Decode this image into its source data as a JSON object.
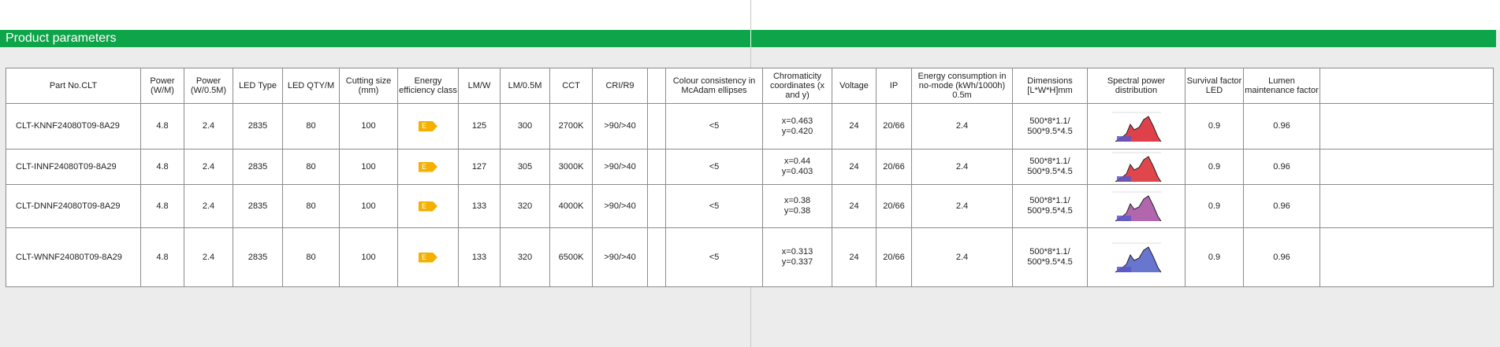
{
  "header": {
    "title": "Product parameters"
  },
  "columns": [
    "Part No.CLT",
    "Power (W/M)",
    "Power (W/0.5M)",
    "LED Type",
    "LED QTY/M",
    "Cutting size (mm)",
    "Energy efficiency class",
    "LM/W",
    "LM/0.5M",
    "CCT",
    "CRI/R9",
    "Colour consistency in McAdam ellipses",
    "Chromaticity coordinates (x and y)",
    "Voltage",
    "IP",
    "Energy consumption in no-mode (kWh/1000h) 0.5m",
    "Dimensions [L*W*H]mm",
    "Spectral power distribution",
    "Survival factor LED",
    "Lumen maintenance factor"
  ],
  "rows": [
    {
      "part": "CLT-KNNF24080T09-8A29",
      "pw_m": "4.8",
      "pw_05": "2.4",
      "led": "2835",
      "qty": "80",
      "cut": "100",
      "ee": "E",
      "lmw": "125",
      "lm05": "300",
      "cct": "2700K",
      "cri": ">90/>40",
      "mcadam": "<5",
      "x": "x=0.463",
      "y": "y=0.420",
      "volt": "24",
      "ip": "20/66",
      "energy": "2.4",
      "dim1": "500*8*1.1/",
      "dim2": "500*9.5*4.5",
      "surv": "0.9",
      "lumen": "0.96",
      "spec_color": "#d8202a"
    },
    {
      "part": "CLT-INNF24080T09-8A29",
      "pw_m": "4.8",
      "pw_05": "2.4",
      "led": "2835",
      "qty": "80",
      "cut": "100",
      "ee": "E",
      "lmw": "127",
      "lm05": "305",
      "cct": "3000K",
      "cri": ">90/>40",
      "mcadam": "<5",
      "x": "x=0.44",
      "y": "y=0.403",
      "volt": "24",
      "ip": "20/66",
      "energy": "2.4",
      "dim1": "500*8*1.1/",
      "dim2": "500*9.5*4.5",
      "surv": "0.9",
      "lumen": "0.96",
      "spec_color": "#d9272b"
    },
    {
      "part": "CLT-DNNF24080T09-8A29",
      "pw_m": "4.8",
      "pw_05": "2.4",
      "led": "2835",
      "qty": "80",
      "cut": "100",
      "ee": "E",
      "lmw": "133",
      "lm05": "320",
      "cct": "4000K",
      "cri": ">90/>40",
      "mcadam": "<5",
      "x": "x=0.38",
      "y": "y=0.38",
      "volt": "24",
      "ip": "20/66",
      "energy": "2.4",
      "dim1": "500*8*1.1/",
      "dim2": "500*9.5*4.5",
      "surv": "0.9",
      "lumen": "0.96",
      "spec_color": "#a44b9f"
    },
    {
      "part": "CLT-WNNF24080T09-8A29",
      "pw_m": "4.8",
      "pw_05": "2.4",
      "led": "2835",
      "qty": "80",
      "cut": "100",
      "ee": "E",
      "lmw": "133",
      "lm05": "320",
      "cct": "6500K",
      "cri": ">90/>40",
      "mcadam": "<5",
      "x": "x=0.313",
      "y": "y=0.337",
      "volt": "24",
      "ip": "20/66",
      "energy": "2.4",
      "dim1": "500*8*1.1/",
      "dim2": "500*9.5*4.5",
      "surv": "0.9",
      "lumen": "0.96",
      "spec_color": "#4d5ec8"
    }
  ]
}
